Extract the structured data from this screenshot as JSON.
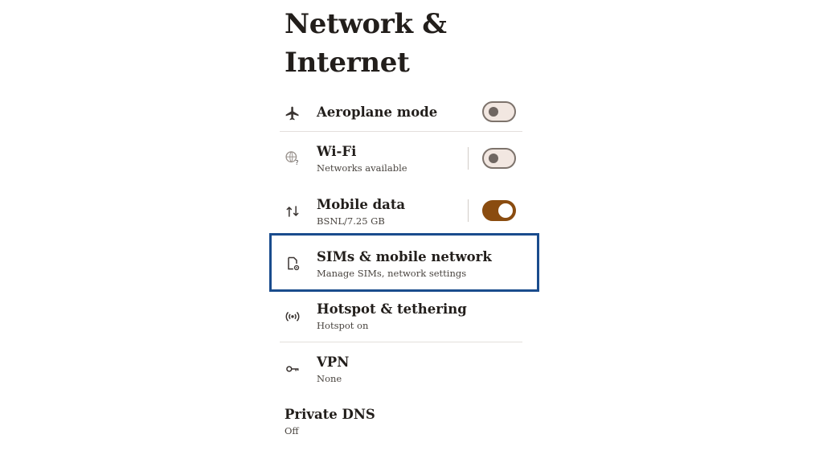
{
  "page": {
    "title": "Network & Internet"
  },
  "items": {
    "aeroplane": {
      "label": "Aeroplane mode",
      "toggle_on": false,
      "icon": "airplane-icon"
    },
    "wifi": {
      "label": "Wi-Fi",
      "sub": "Networks available",
      "toggle_on": false,
      "icon": "wifi-unknown-icon"
    },
    "mobile_data": {
      "label": "Mobile data",
      "sub": "BSNL/7.25 GB",
      "toggle_on": true,
      "icon": "data-arrows-icon"
    },
    "sims": {
      "label": "SIMs & mobile network",
      "sub": "Manage SIMs, network settings",
      "icon": "sim-settings-icon",
      "highlighted": true
    },
    "hotspot": {
      "label": "Hotspot & tethering",
      "sub": "Hotspot on",
      "icon": "hotspot-icon"
    },
    "vpn": {
      "label": "VPN",
      "sub": "None",
      "icon": "key-icon"
    },
    "private_dns": {
      "label": "Private DNS",
      "sub": "Off"
    }
  },
  "colors": {
    "toggle_on": "#8a4c10",
    "toggle_off_bg": "#f2e7e1",
    "highlight_border": "#1a4c8d",
    "text": "#221e1b"
  }
}
